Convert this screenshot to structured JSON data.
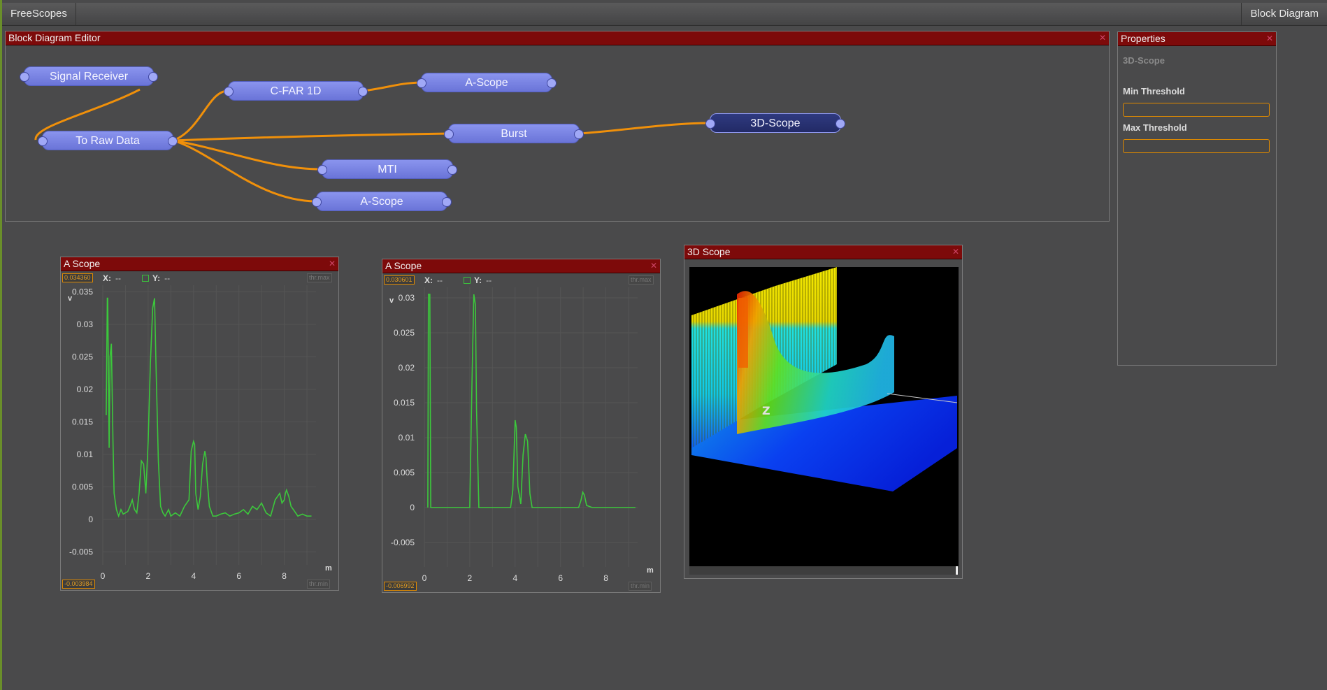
{
  "topbar": {
    "app_name": "FreeScopes",
    "view_menu": "Block Diagram"
  },
  "block_editor": {
    "title": "Block Diagram Editor",
    "nodes": {
      "signal_receiver": "Signal Receiver",
      "to_raw_data": "To Raw Data",
      "cfar": "C-FAR 1D",
      "ascope_top": "A-Scope",
      "burst": "Burst",
      "mti": "MTI",
      "ascope_bottom": "A-Scope",
      "scope3d": "3D-Scope"
    },
    "selected_node": "3D-Scope",
    "wire_color": "#f0900a"
  },
  "properties": {
    "title": "Properties",
    "subtitle": "3D-Scope",
    "min_label": "Min Threshold",
    "min_value": "",
    "max_label": "Max Threshold",
    "max_value": ""
  },
  "scope1": {
    "title": "A Scope",
    "max_badge": "0.034360",
    "min_badge": "-0.003984",
    "thr_max": "thr.max",
    "thr_min": "thr.min",
    "x_label": "X:",
    "x_value": "--",
    "y_label": "Y:",
    "y_value": "--",
    "y_unit": "v",
    "x_unit": "m"
  },
  "scope2": {
    "title": "A Scope",
    "max_badge": "0.030601",
    "min_badge": "-0.006992",
    "thr_max": "thr.max",
    "thr_min": "thr.min",
    "x_label": "X:",
    "x_value": "--",
    "y_label": "Y:",
    "y_value": "--",
    "y_unit": "v",
    "x_unit": "m"
  },
  "scope3d": {
    "title": "3D Scope",
    "axis_label": "Z"
  },
  "chart_data": [
    {
      "type": "line",
      "title": "A Scope",
      "xlabel": "m",
      "ylabel": "v",
      "xlim": [
        0,
        9.4
      ],
      "ylim": [
        -0.007,
        0.036
      ],
      "x_ticks": [
        0,
        2,
        4,
        6,
        8
      ],
      "y_ticks": [
        -0.005,
        0,
        0.005,
        0.01,
        0.015,
        0.02,
        0.025,
        0.03,
        0.035
      ],
      "grid": true,
      "color": "#3cc83c",
      "series": [
        {
          "x": [
            0.15,
            0.2,
            0.22,
            0.28,
            0.32,
            0.38,
            0.45,
            0.5,
            0.6,
            0.7,
            0.8,
            0.9,
            1.0,
            1.1,
            1.2,
            1.3,
            1.4,
            1.5,
            1.6,
            1.7,
            1.8,
            1.9,
            2.0,
            2.1,
            2.2,
            2.28,
            2.35,
            2.45,
            2.55,
            2.65,
            2.75,
            2.9,
            3.0,
            3.2,
            3.4,
            3.6,
            3.8,
            3.9,
            4.0,
            4.05,
            4.1,
            4.2,
            4.3,
            4.4,
            4.5,
            4.55,
            4.6,
            4.7,
            4.85,
            5.0,
            5.2,
            5.4,
            5.6,
            5.8,
            6.0,
            6.2,
            6.4,
            6.6,
            6.8,
            7.0,
            7.2,
            7.4,
            7.6,
            7.8,
            7.9,
            8.0,
            8.05,
            8.1,
            8.2,
            8.3,
            8.4,
            8.6,
            8.8,
            9.0,
            9.2
          ],
          "y": [
            0.016,
            0.034,
            0.034,
            0.011,
            0.025,
            0.027,
            0.012,
            0.004,
            0.0015,
            0.0005,
            0.0015,
            0.0008,
            0.001,
            0.0012,
            0.002,
            0.003,
            0.0015,
            0.001,
            0.004,
            0.009,
            0.0085,
            0.004,
            0.012,
            0.024,
            0.0325,
            0.034,
            0.023,
            0.009,
            0.002,
            0.001,
            0.0005,
            0.0015,
            0.0005,
            0.001,
            0.0005,
            0.002,
            0.003,
            0.0105,
            0.012,
            0.0115,
            0.004,
            0.0015,
            0.0035,
            0.0085,
            0.0105,
            0.0095,
            0.006,
            0.002,
            0.0005,
            0.0005,
            0.0008,
            0.001,
            0.0005,
            0.0008,
            0.001,
            0.0015,
            0.0008,
            0.002,
            0.0015,
            0.0025,
            0.001,
            0.0005,
            0.003,
            0.004,
            0.0025,
            0.003,
            0.004,
            0.0045,
            0.0035,
            0.002,
            0.0015,
            0.0005,
            0.0008,
            0.0005,
            0.0005
          ]
        }
      ]
    },
    {
      "type": "line",
      "title": "A Scope",
      "xlabel": "m",
      "ylabel": "v",
      "xlim": [
        0,
        9.4
      ],
      "ylim": [
        -0.0085,
        0.0315
      ],
      "x_ticks": [
        0,
        2,
        4,
        6,
        8
      ],
      "y_ticks": [
        -0.005,
        0,
        0.005,
        0.01,
        0.015,
        0.02,
        0.025,
        0.03
      ],
      "grid": true,
      "color": "#3cc83c",
      "series": [
        {
          "x": [
            0.15,
            0.18,
            0.2,
            0.24,
            0.28,
            1.0,
            1.9,
            2.0,
            2.1,
            2.18,
            2.25,
            2.3,
            2.4,
            2.5,
            3.8,
            3.9,
            4.0,
            4.05,
            4.12,
            4.25,
            4.35,
            4.45,
            4.55,
            4.65,
            4.75,
            6.6,
            6.8,
            6.9,
            6.98,
            7.05,
            7.15,
            7.4,
            8.5,
            9.3
          ],
          "y": [
            0,
            0.0305,
            0.0305,
            0.0305,
            0,
            0,
            0,
            0,
            0.018,
            0.0305,
            0.029,
            0.014,
            0,
            0,
            0,
            0.0025,
            0.0125,
            0.0115,
            0.003,
            0.0005,
            0.0075,
            0.0105,
            0.0095,
            0.002,
            0,
            0,
            0,
            0.001,
            0.0022,
            0.0018,
            0.0003,
            0,
            0,
            0
          ]
        }
      ]
    }
  ]
}
